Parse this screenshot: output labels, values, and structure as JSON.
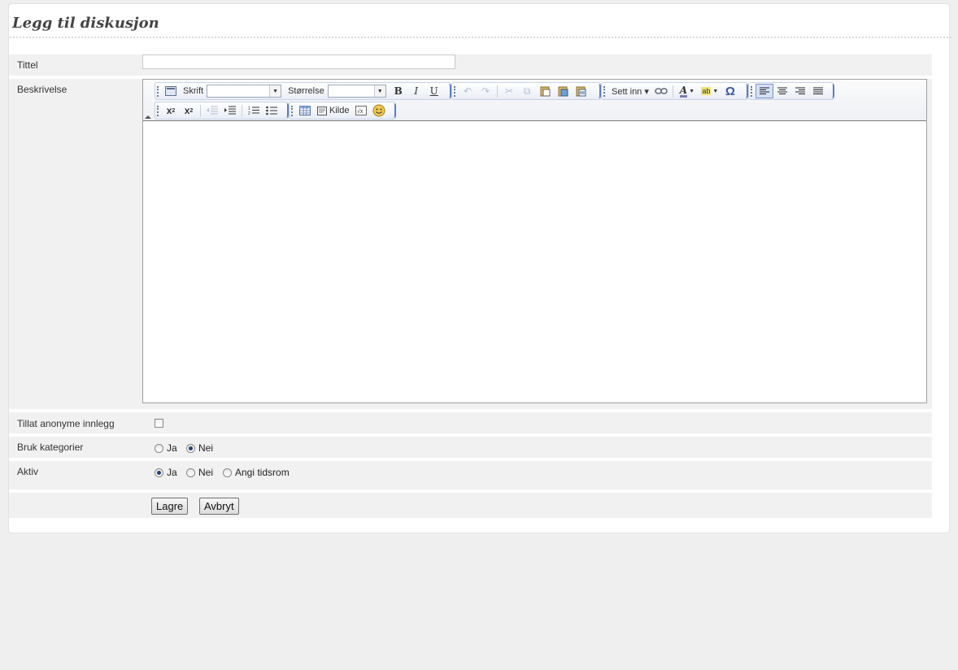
{
  "page": {
    "heading": "Legg til diskusjon"
  },
  "form": {
    "title_label": "Tittel",
    "title_value": "",
    "description_label": "Beskrivelse",
    "anonymous_label": "Tillat anonyme innlegg",
    "anonymous_checked": false,
    "categories_label": "Bruk kategorier",
    "categories_options": [
      "Ja",
      "Nei"
    ],
    "categories_selected": "Nei",
    "active_label": "Aktiv",
    "active_options": [
      "Ja",
      "Nei",
      "Angi tidsrom"
    ],
    "active_selected": "Ja",
    "save_button": "Lagre",
    "cancel_button": "Avbryt"
  },
  "editor": {
    "font_label": "Skrift",
    "font_value": "",
    "size_label": "Størrelse",
    "size_value": "",
    "insert_label": "Sett inn",
    "source_label": "Kilde",
    "color_text_glyph": "A",
    "align_left_active": true,
    "toolbar_icons": [
      "document-icon",
      "bold-icon",
      "italic-icon",
      "underline-icon",
      "undo-icon",
      "redo-icon",
      "cut-icon",
      "copy-icon",
      "paste-icon",
      "paste-text-icon",
      "paste-word-icon",
      "link-icon",
      "text-color-icon",
      "highlight-icon",
      "special-char-icon",
      "align-left-icon",
      "align-center-icon",
      "align-right-icon",
      "justify-icon",
      "subscript-icon",
      "superscript-icon",
      "outdent-icon",
      "indent-icon",
      "ordered-list-icon",
      "unordered-list-icon",
      "table-icon",
      "source-icon",
      "formula-icon",
      "smiley-icon"
    ]
  }
}
